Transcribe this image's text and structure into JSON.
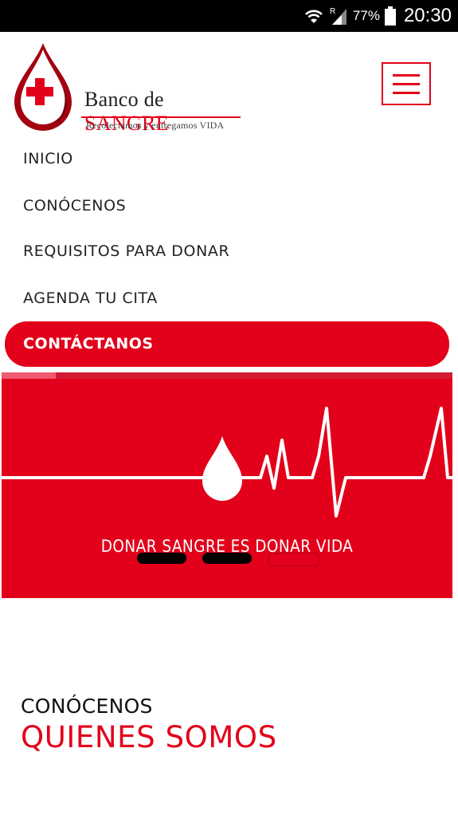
{
  "status_bar": {
    "battery_percent": "77%",
    "time": "20:30",
    "signal_label": "R",
    "icons": [
      "wifi-icon",
      "signal-icon",
      "battery-icon"
    ]
  },
  "header": {
    "brand_prefix": "Banco de ",
    "brand_accent": "SANGRE",
    "tagline": "Recolectamos y entregamos VIDA",
    "menu_icon": "hamburger-icon"
  },
  "nav": {
    "items": [
      {
        "label": "INICIO"
      },
      {
        "label": "CONÓCENOS"
      },
      {
        "label": "REQUISITOS PARA DONAR"
      },
      {
        "label": "AGENDA TU CITA"
      },
      {
        "label": "CONTÁCTANOS"
      }
    ],
    "active_index": 4
  },
  "slider": {
    "caption": "DONAR SANGRE ES DONAR VIDA",
    "progress": 0.12,
    "slide_count": 3,
    "active_slide": 2
  },
  "section": {
    "kicker": "CONÓCENOS",
    "title": "QUIENES SOMOS"
  },
  "colors": {
    "brand_red": "#e2001a",
    "text_dark": "#222222",
    "status_bar": "#000000"
  }
}
